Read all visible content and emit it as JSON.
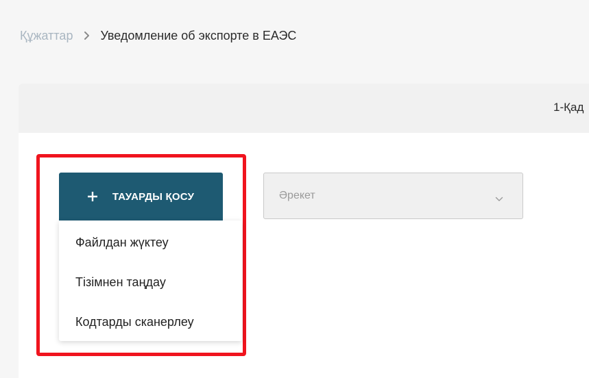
{
  "breadcrumb": {
    "parent": "Құжаттар",
    "current": "Уведомление об экспорте в ЕАЭС"
  },
  "card": {
    "step_label": "1-Қад"
  },
  "add_button": {
    "label": "ТАУАРДЫ ҚОСУ"
  },
  "add_menu": {
    "items": [
      {
        "label": "Файлдан жүктеу"
      },
      {
        "label": "Тізімнен таңдау"
      },
      {
        "label": "Кодтарды сканерлеу"
      }
    ]
  },
  "action_select": {
    "placeholder": "Әрекет"
  },
  "icons": {
    "breadcrumb_separator": "chevron-right-icon",
    "add": "plus-icon",
    "select_arrow": "chevron-down-icon"
  },
  "colors": {
    "primary": "#1e5a72",
    "highlight": "#f0141e",
    "breadcrumb_link": "#a9b6c1"
  }
}
